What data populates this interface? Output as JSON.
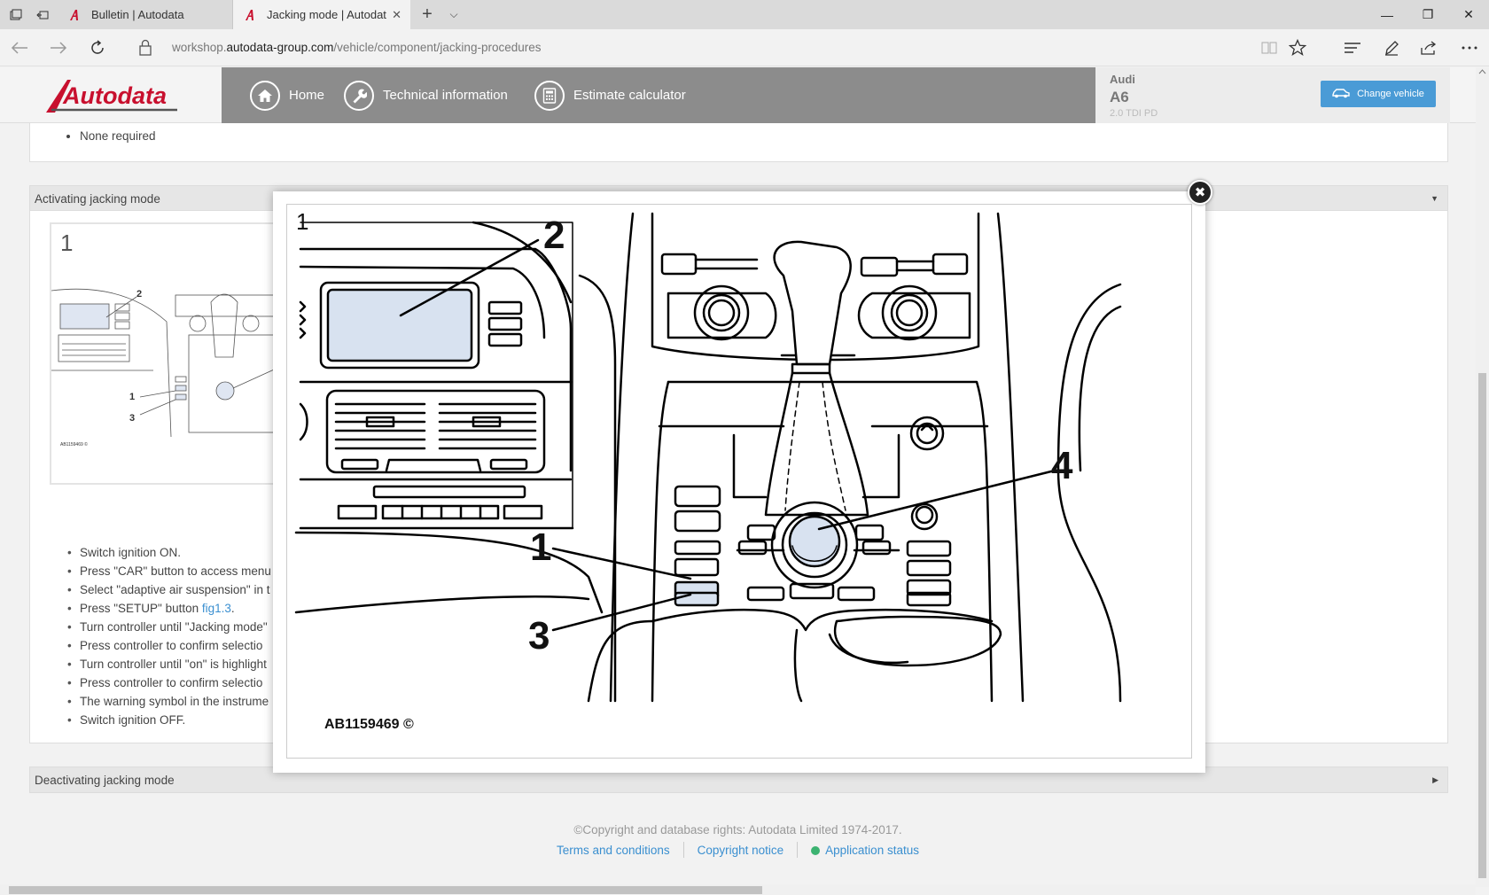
{
  "browser": {
    "tabs": [
      {
        "title": "Bulletin | Autodata",
        "active": false
      },
      {
        "title": "Jacking mode | Autodat",
        "active": true
      }
    ],
    "url_prefix": "workshop.",
    "url_host": "autodata-group.com",
    "url_path": "/vehicle/component/jacking-procedures",
    "tab_close": "✕",
    "new_tab": "+",
    "tab_menu": "⌵",
    "window": {
      "minimize": "—",
      "restore": "❐",
      "close": "✕"
    }
  },
  "header": {
    "logo_text": "Autodata",
    "nav": [
      {
        "label": "Home",
        "icon": "home-icon"
      },
      {
        "label": "Technical information",
        "icon": "wrench-icon"
      },
      {
        "label": "Estimate calculator",
        "icon": "calculator-icon"
      }
    ],
    "vehicle": {
      "make": "Audi",
      "model": "A6",
      "engine": "2.0 TDI PD"
    },
    "change_vehicle": "Change vehicle"
  },
  "content": {
    "prev_item": "None required",
    "section_active": "Activating jacking mode",
    "thumb_number": "1",
    "steps": [
      "Switch ignition ON.",
      "Press \"CAR\" button to access menu",
      "Select \"adaptive air suspension\" in t",
      "Press \"SETUP\" button ",
      "Turn controller until \"Jacking mode\"",
      "Press controller to confirm selectio",
      "Turn controller until \"on\" is highlight",
      "Press controller to confirm selectio",
      "The warning symbol in the instrume",
      "Switch ignition OFF."
    ],
    "step_link": "fig1.3",
    "section_next": "Deactivating jacking mode"
  },
  "footer": {
    "copyright": "©Copyright and database rights: Autodata Limited 1974-2017.",
    "links": [
      "Terms and conditions",
      "Copyright notice",
      "Application status"
    ]
  },
  "modal": {
    "figure_number": "1",
    "callouts": [
      "1",
      "2",
      "3",
      "4"
    ],
    "figure_code": "AB1159469 ©",
    "close_icon": "✖"
  },
  "colors": {
    "nav_bg": "#8c8c8c",
    "accent": "#4a9bd6",
    "link": "#3a8fd0",
    "logo_red": "#c8102e",
    "status_green": "#3cb371",
    "highlight": "#d8e2f0"
  }
}
